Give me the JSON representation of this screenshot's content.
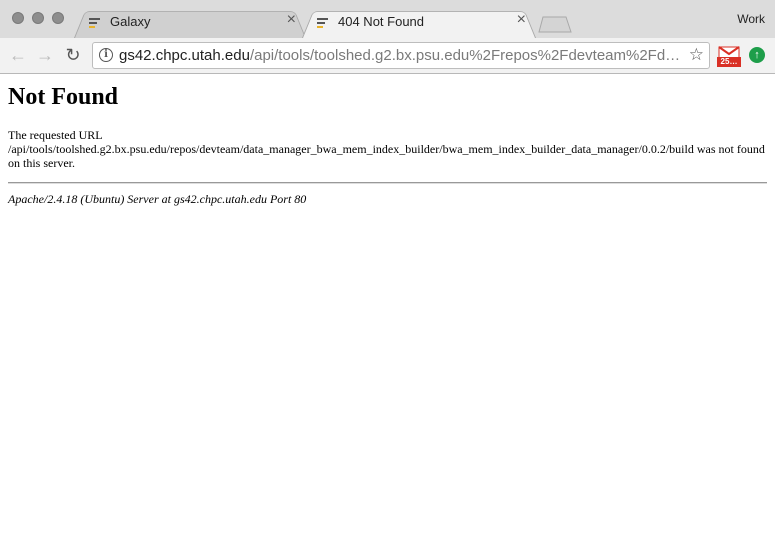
{
  "browser": {
    "tabs": [
      {
        "title": "Galaxy",
        "close": "×"
      },
      {
        "title": "404 Not Found",
        "close": "×"
      }
    ],
    "profile_label": "Work",
    "address": {
      "host": "gs42.chpc.utah.edu",
      "path": "/api/tools/toolshed.g2.bx.psu.edu%2Frepos%2Fdevteam%2Fd…"
    },
    "extensions": {
      "gmail_badge": "25…"
    }
  },
  "page": {
    "heading": "Not Found",
    "message": "The requested URL /api/tools/toolshed.g2.bx.psu.edu/repos/devteam/data_manager_bwa_mem_index_builder/bwa_mem_index_builder_data_manager/0.0.2/build was not found on this server.",
    "server_signature": "Apache/2.4.18 (Ubuntu) Server at gs42.chpc.utah.edu Port 80"
  }
}
